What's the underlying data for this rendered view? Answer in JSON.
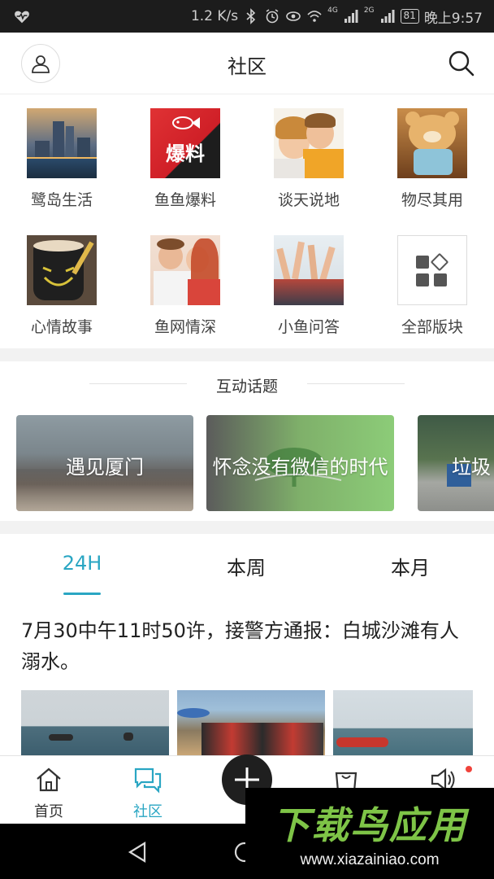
{
  "status_bar": {
    "network_speed": "1.2 K/s",
    "signal_4g": "4G",
    "signal_2g": "2G",
    "battery": "81",
    "time": "晚上9:57"
  },
  "header": {
    "title": "社区"
  },
  "grid": [
    {
      "label": "鹭岛生活",
      "icon": "city-skyline"
    },
    {
      "label": "鱼鱼爆料",
      "icon": "fish-news",
      "badge": "爆料"
    },
    {
      "label": "谈天说地",
      "icon": "kids-whisper"
    },
    {
      "label": "物尽其用",
      "icon": "teddy-bear"
    },
    {
      "label": "心情故事",
      "icon": "coffee-cup"
    },
    {
      "label": "鱼网情深",
      "icon": "couple"
    },
    {
      "label": "小鱼问答",
      "icon": "raised-hands"
    },
    {
      "label": "全部版块",
      "icon": "all-sections"
    }
  ],
  "topics": {
    "title": "互动话题",
    "items": [
      {
        "label": "遇见厦门"
      },
      {
        "label": "怀念没有微信的时代"
      },
      {
        "label": "垃圾"
      }
    ]
  },
  "tabs": [
    {
      "label": "24H",
      "active": true
    },
    {
      "label": "本周"
    },
    {
      "label": "本月"
    }
  ],
  "post": {
    "text": "7月30中午11时50许，接警方通报：白城沙滩有人溺水。"
  },
  "bottom_nav": [
    {
      "label": "首页",
      "icon": "home-icon"
    },
    {
      "label": "社区",
      "icon": "chat-icon",
      "active": true
    },
    {
      "label": "",
      "icon": "plus-icon"
    },
    {
      "label": "",
      "icon": "shopping-bag-icon"
    },
    {
      "label": "",
      "icon": "speaker-icon"
    }
  ],
  "watermark": {
    "title": "下载鸟应用",
    "url": "www.xiazainiao.com"
  },
  "colors": {
    "accent": "#2aa6c3",
    "notification": "#f0433b",
    "status_bar": "#1c1c1c"
  }
}
